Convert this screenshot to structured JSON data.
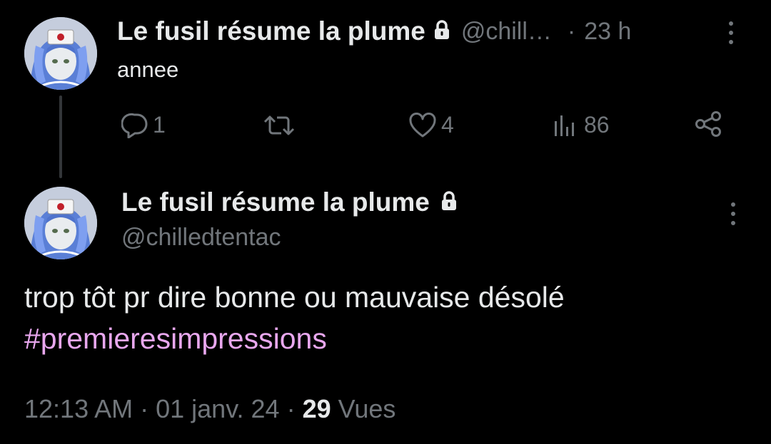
{
  "reply_tweet": {
    "author_name": "Le fusil résume la plume",
    "handle": "@chill…",
    "separator": "·",
    "time": "23 h",
    "text": "annee",
    "replies": "1",
    "likes": "4",
    "views": "86"
  },
  "main_tweet": {
    "author_name": "Le fusil résume la plume",
    "handle": "@chilledtentac",
    "text": "trop tôt pr dire bonne ou mauvaise désolé",
    "hashtag": "#premieresimpressions",
    "time": "12:13 AM",
    "sep1": "·",
    "date": "01 janv. 24",
    "sep2": "·",
    "views_count": "29",
    "views_label": "Vues"
  },
  "colors": {
    "background": "#000000",
    "text": "#e7e9ea",
    "muted": "#71767b",
    "hashtag": "#e8a7ee"
  },
  "icons": [
    "avatar",
    "lock-icon",
    "more-icon",
    "reply-icon",
    "retweet-icon",
    "like-icon",
    "views-icon",
    "share-icon"
  ]
}
